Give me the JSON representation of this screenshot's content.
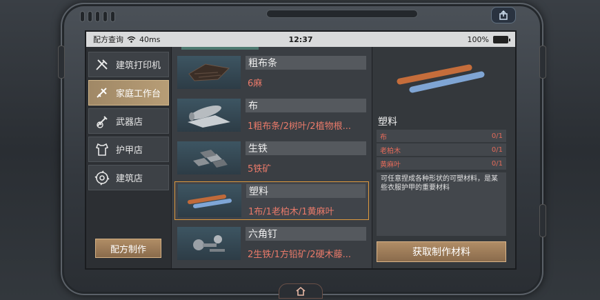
{
  "status": {
    "carrier": "配方查询",
    "signal": "40ms",
    "time": "12:37",
    "battery": "100%"
  },
  "nav": {
    "items": [
      {
        "label": "建筑打印机",
        "icon": "printer-tools-icon",
        "active": false
      },
      {
        "label": "家庭工作台",
        "icon": "workbench-icon",
        "active": true
      },
      {
        "label": "武器店",
        "icon": "weapon-icon",
        "active": false
      },
      {
        "label": "护甲店",
        "icon": "armor-icon",
        "active": false
      },
      {
        "label": "建筑店",
        "icon": "saw-blade-icon",
        "active": false
      }
    ],
    "recipe_button": "配方制作"
  },
  "list": {
    "items": [
      {
        "name": "粗布条",
        "req": "6麻",
        "thumb": "cloth-strip-icon"
      },
      {
        "name": "布",
        "req": "1粗布条/2树叶/2植物根...",
        "thumb": "cloth-roll-icon"
      },
      {
        "name": "生铁",
        "req": "5铁矿",
        "thumb": "iron-ingot-icon"
      },
      {
        "name": "塑料",
        "req": "1布/1老柏木/1黄麻叶",
        "thumb": "plastic-tubes-icon",
        "selected": true
      },
      {
        "name": "六角钉",
        "req": "2生铁/1方铅矿/2硬木藤...",
        "thumb": "hex-bolts-icon"
      }
    ]
  },
  "detail": {
    "title": "塑料",
    "materials": [
      {
        "name": "布",
        "count": "0/1"
      },
      {
        "name": "老柏木",
        "count": "0/1"
      },
      {
        "name": "黄麻叶",
        "count": "0/1"
      }
    ],
    "description": "可任意捏成各种形状的可塑材料，是某些衣服护甲的重要材料",
    "get_button": "获取制作材料"
  },
  "colors": {
    "accent": "#e09a3e",
    "requirement": "#e97a6a",
    "button": "#a08866"
  }
}
